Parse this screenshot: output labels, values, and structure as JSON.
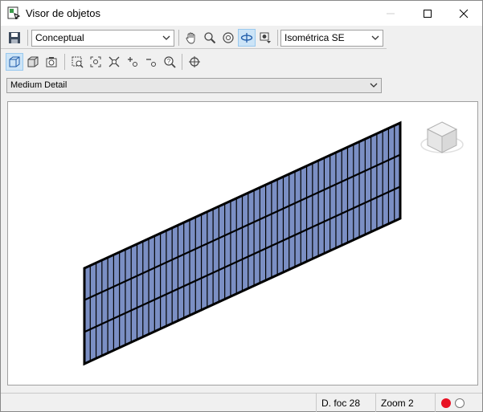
{
  "window": {
    "title": "Visor de objetos"
  },
  "toolbar": {
    "visual_style": "Conceptual",
    "view": "Isométrica SE"
  },
  "detail_level": "Medium Detail",
  "status": {
    "focal": "D. foc 28",
    "zoom": "Zoom 2"
  },
  "colors": {
    "panel_fill": "#7b8fc4",
    "panel_stroke": "#000000",
    "active_button": "#cce4f7",
    "status_red": "#e81123"
  },
  "icons": {
    "save": "save-icon",
    "pan": "pan-hand-icon",
    "zoom": "zoom-icon",
    "orbit": "orbit-icon",
    "orbit3d": "3d-orbit-icon",
    "camera": "camera-icon",
    "wireframe": "wireframe-box-icon",
    "shaded": "shaded-box-icon",
    "screenshot": "screenshot-icon"
  }
}
